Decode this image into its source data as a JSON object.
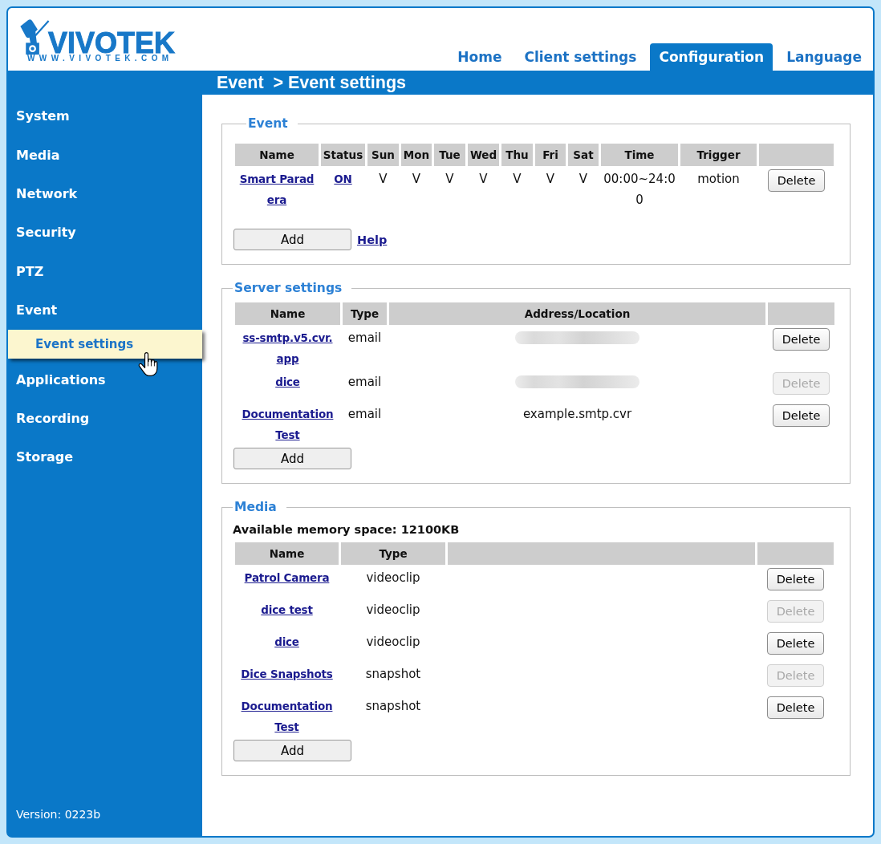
{
  "logo": {
    "wordmark": "VIVOTEK",
    "url": "WWW.VIVOTEK.COM"
  },
  "tabs": [
    {
      "label": "Home",
      "selected": false
    },
    {
      "label": "Client settings",
      "selected": false
    },
    {
      "label": "Configuration",
      "selected": true
    },
    {
      "label": "Language",
      "selected": false
    }
  ],
  "breadcrumb": "Event  > Event settings",
  "sidebar": {
    "items": [
      {
        "label": "System",
        "selected": false
      },
      {
        "label": "Media",
        "selected": false
      },
      {
        "label": "Network",
        "selected": false
      },
      {
        "label": "Security",
        "selected": false
      },
      {
        "label": "PTZ",
        "selected": false
      },
      {
        "label": "Event",
        "selected": false,
        "children": [
          {
            "label": "Event settings",
            "selected": true
          }
        ]
      },
      {
        "label": "Applications",
        "selected": false
      },
      {
        "label": "Recording",
        "selected": false
      },
      {
        "label": "Storage",
        "selected": false
      }
    ],
    "version": "Version: 0223b"
  },
  "sections": [
    {
      "kind": "event",
      "title": "Event",
      "columns": [
        "Name",
        "Status",
        "Sun",
        "Mon",
        "Tue",
        "Wed",
        "Thu",
        "Fri",
        "Sat",
        "Time",
        "Trigger"
      ],
      "rows": [
        {
          "name": "Smart Paradera",
          "status": "ON",
          "days": [
            "V",
            "V",
            "V",
            "V",
            "V",
            "V",
            "V"
          ],
          "time": "00:00~24:00",
          "trigger": "motion",
          "delete": {
            "label": "Delete",
            "disabled": false
          }
        }
      ],
      "add": "Add",
      "help": "Help"
    },
    {
      "kind": "server",
      "title": "Server settings",
      "columns": [
        "Name",
        "Type",
        "Address/Location"
      ],
      "rows": [
        {
          "name": "ss-smtp.v5.cvr.app",
          "type": "email",
          "redacted": true,
          "delete": {
            "label": "Delete",
            "disabled": false
          }
        },
        {
          "name": "dice",
          "type": "email",
          "redacted": true,
          "delete": {
            "label": "Delete",
            "disabled": true
          }
        },
        {
          "name": "Documentation Test",
          "type": "email",
          "redacted": false,
          "address": "example.smtp.cvr",
          "delete": {
            "label": "Delete",
            "disabled": false
          }
        }
      ],
      "add": "Add"
    },
    {
      "kind": "media",
      "title": "Media",
      "memory": "Available memory space: 12100KB",
      "columns": [
        "Name",
        "Type"
      ],
      "rows": [
        {
          "name": "Patrol Camera",
          "type": "videoclip",
          "delete": {
            "label": "Delete",
            "disabled": false
          }
        },
        {
          "name": "dice test",
          "type": "videoclip",
          "delete": {
            "label": "Delete",
            "disabled": true
          }
        },
        {
          "name": "dice",
          "type": "videoclip",
          "delete": {
            "label": "Delete",
            "disabled": false
          }
        },
        {
          "name": "Dice Snapshots",
          "type": "snapshot",
          "delete": {
            "label": "Delete",
            "disabled": true
          }
        },
        {
          "name": "Documentation Test",
          "type": "snapshot",
          "delete": {
            "label": "Delete",
            "disabled": false
          }
        }
      ],
      "add": "Add"
    }
  ]
}
